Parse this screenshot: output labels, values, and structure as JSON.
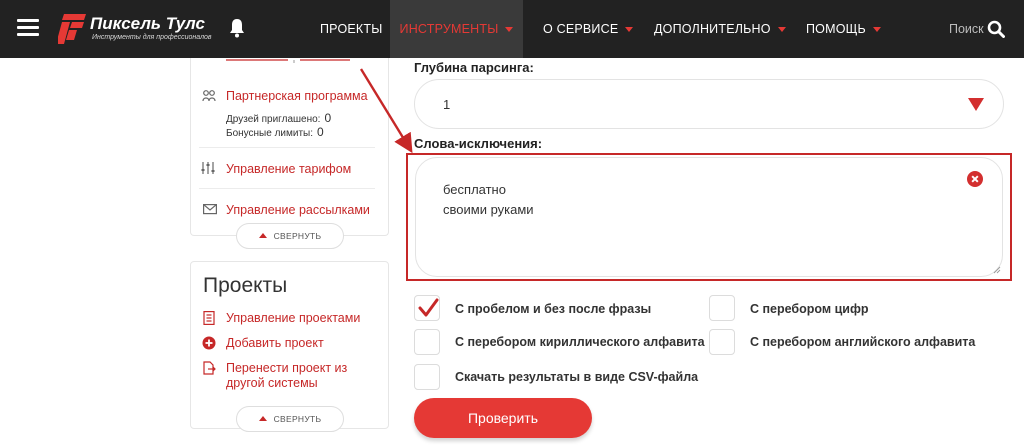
{
  "header": {
    "logo_name": "Пиксель Тулс",
    "logo_subtitle": "Инструменты для профессионалов",
    "nav": [
      {
        "label": "ПРОЕКТЫ",
        "has_caret": false
      },
      {
        "label": "ИНСТРУМЕНТЫ",
        "has_caret": true,
        "active": true
      },
      {
        "label": "О СЕРВИСЕ",
        "has_caret": true
      },
      {
        "label": "ДОПОЛНИТЕЛЬНО",
        "has_caret": true
      },
      {
        "label": "ПОМОЩЬ",
        "has_caret": true
      }
    ],
    "search_label": "Поиск",
    "accent_color": "#e53935",
    "bar_color": "#222222"
  },
  "sidebar": {
    "partner_program": "Партнерская программа",
    "friends_invited_label": "Друзей приглашено:",
    "friends_invited_value": "0",
    "bonus_limits_label": "Бонусные лимиты:",
    "bonus_limits_value": "0",
    "manage_tariff": "Управление тарифом",
    "manage_mailings": "Управление рассылками",
    "collapse_label": "СВЕРНУТЬ",
    "projects": {
      "title": "Проекты",
      "manage": "Управление проектами",
      "add": "Добавить проект",
      "move_line1": "Перенести проект из",
      "move_line2": "другой системы",
      "collapse_label": "СВЕРНУТЬ"
    }
  },
  "form": {
    "depth_label": "Глубина парсинга:",
    "depth_value": "1",
    "stopwords_label": "Слова-исключения:",
    "stopwords_lines": [
      "бесплатно",
      "своими руками"
    ],
    "checkboxes": [
      {
        "label": "С пробелом и без после фразы",
        "checked": true
      },
      {
        "label": "С перебором цифр",
        "checked": false
      },
      {
        "label": "С перебором кириллического алфавита",
        "checked": false
      },
      {
        "label": "С перебором английского алфавита",
        "checked": false
      },
      {
        "label": "Скачать результаты в виде CSV-файла",
        "checked": false
      }
    ],
    "submit_label": "Проверить"
  }
}
